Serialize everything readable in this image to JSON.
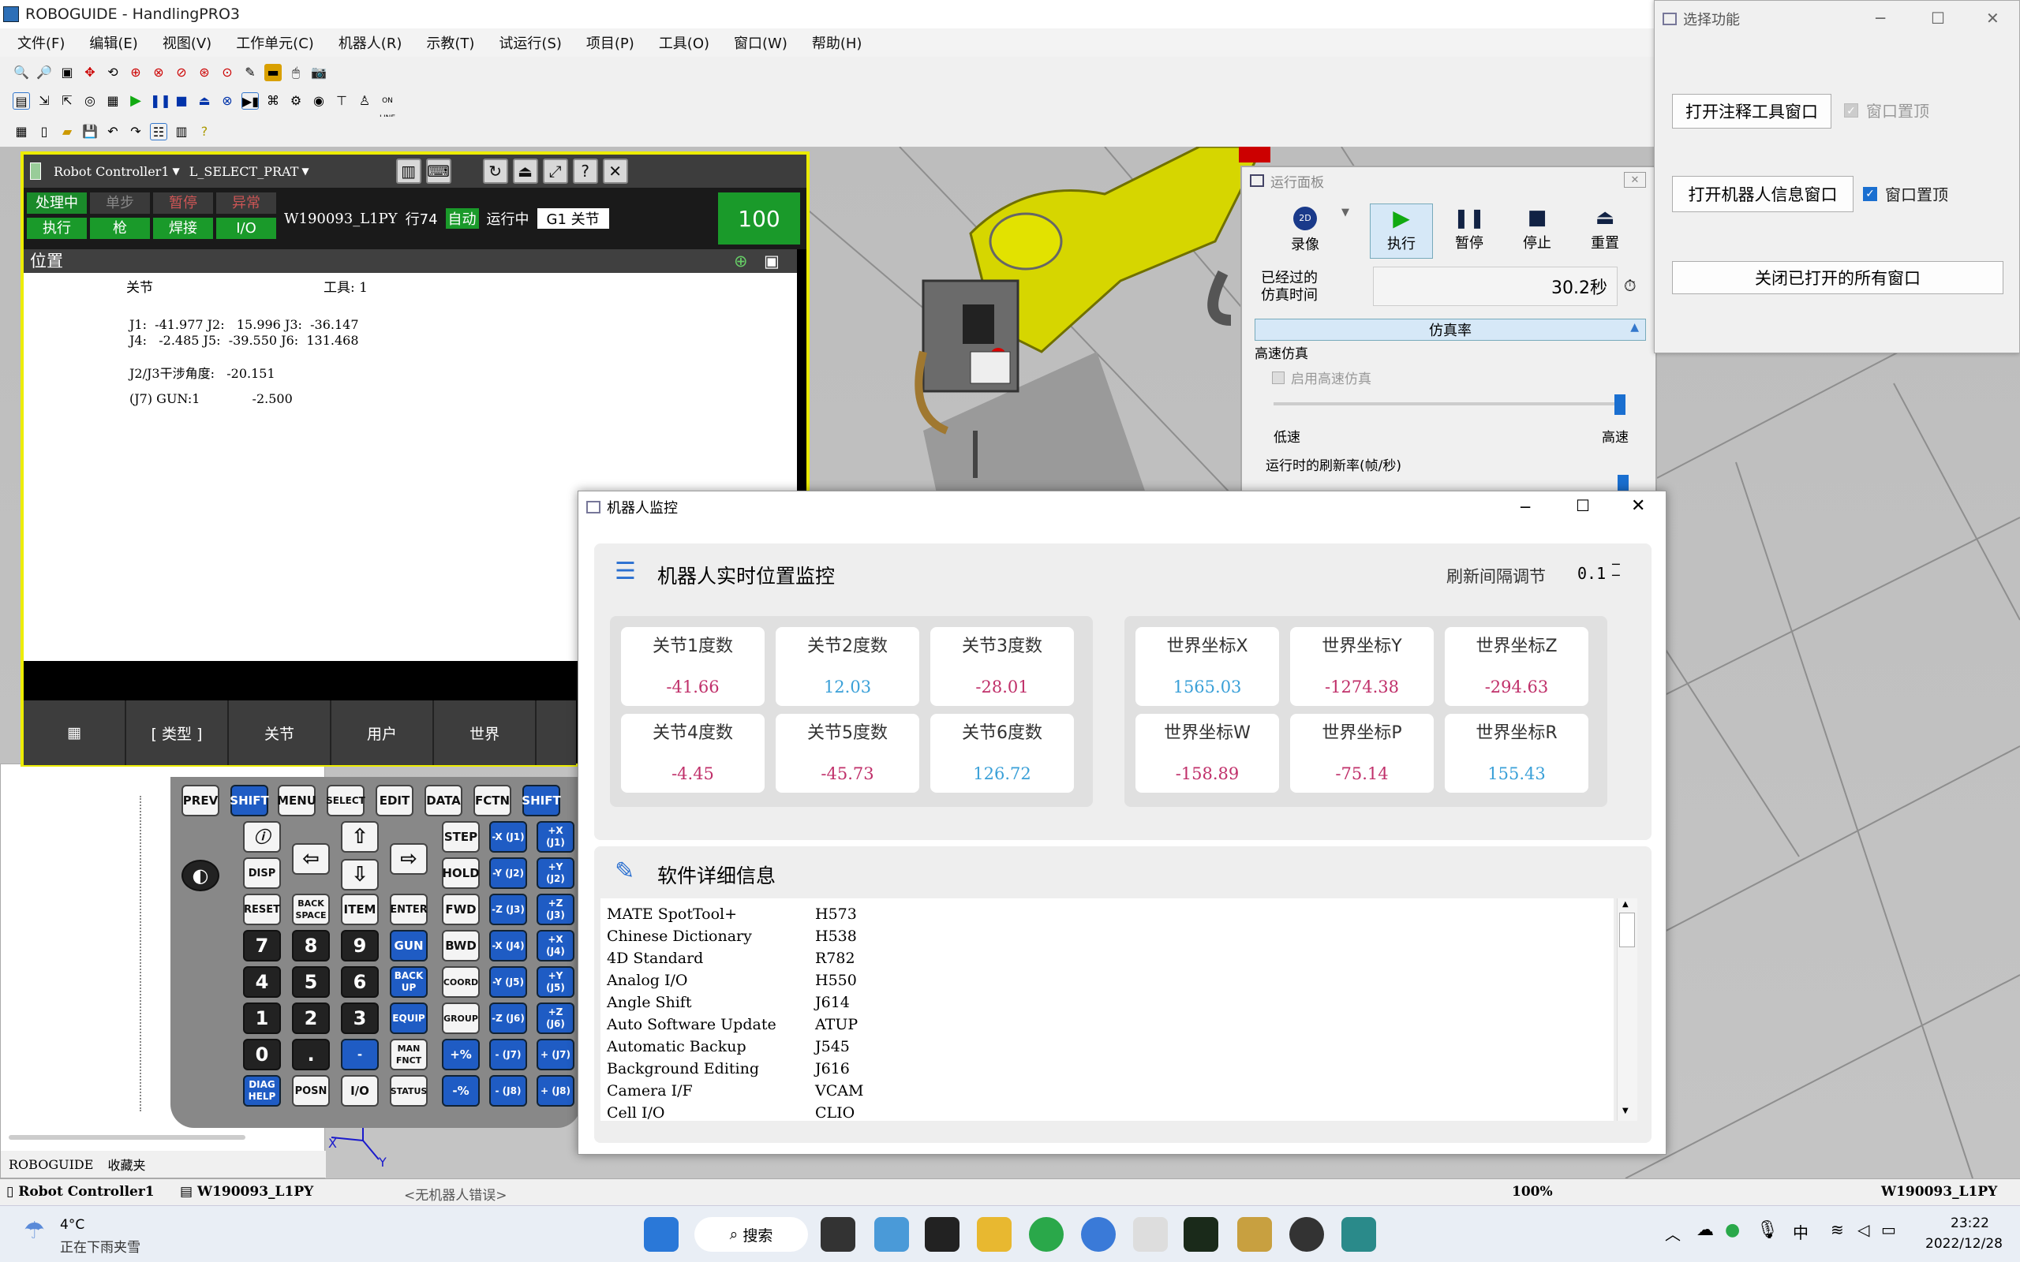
{
  "app": {
    "title": "ROBOGUIDE - HandlingPRO3"
  },
  "menu": [
    "文件(F)",
    "编辑(E)",
    "视图(V)",
    "工作单元(C)",
    "机器人(R)",
    "示教(T)",
    "试运行(S)",
    "项目(P)",
    "工具(O)",
    "窗口(W)",
    "帮助(H)"
  ],
  "pendant": {
    "controller": "Robot Controller1",
    "program_select": "L_SELECT_PRAT",
    "status_top": [
      "处理中",
      "单步",
      "暂停",
      "异常"
    ],
    "status_bottom": [
      "执行",
      "枪",
      "焊接",
      "I/O"
    ],
    "program": "W190093_L1PY",
    "line": "行74",
    "mode": "自动",
    "state": "运行中",
    "group": "G1 关节",
    "override": "100",
    "screen_title": "位置",
    "coord_label": "关节",
    "tool_label": "工具:  1",
    "joints_line1": "J1:  -41.977 J2:   15.996 J3:  -36.147",
    "joints_line2": "J4:   -2.485 J5:  -39.550 J6:  131.468",
    "interference": "J2/J3干涉角度:   -20.151",
    "gun": "(J7) GUN:1             -2.500",
    "fkeys": [
      "[ 类型 ]",
      "关节",
      "用户",
      "世界"
    ]
  },
  "keypad": {
    "r1": [
      "PREV",
      "SHIFT",
      "MENU",
      "SELECT",
      "EDIT",
      "DATA",
      "FCTN",
      "SHIFT"
    ],
    "r2": [
      "STEP",
      "-X (J1)",
      "+X (J1)"
    ],
    "r3": [
      "DISP",
      "HOLD",
      "-Y (J2)",
      "+Y (J2)"
    ],
    "r4": [
      "RESET",
      "BACK SPACE",
      "ITEM",
      "ENTER",
      "FWD",
      "-Z (J3)",
      "+Z (J3)"
    ],
    "r5": [
      "7",
      "8",
      "9",
      "GUN",
      "BWD",
      "-X (J4)",
      "+X (J4)"
    ],
    "r6": [
      "4",
      "5",
      "6",
      "BACK UP",
      "COORD",
      "-Y (J5)",
      "+Y (J5)"
    ],
    "r7": [
      "1",
      "2",
      "3",
      "EQUIP",
      "GROUP",
      "-Z (J6)",
      "+Z (J6)"
    ],
    "r8": [
      "0",
      ".",
      "-",
      "MAN FNCT",
      "+%",
      "- (J7)",
      "+ (J7)"
    ],
    "r9": [
      "DIAG HELP",
      "POSN",
      "I/O",
      "STATUS",
      "-%",
      "- (J8)",
      "+ (J8)"
    ]
  },
  "run_panel": {
    "title": "运行面板",
    "buttons": [
      "录像",
      "执行",
      "暂停",
      "停止",
      "重置"
    ],
    "elapsed_label1": "已经过的",
    "elapsed_label2": "仿真时间",
    "elapsed_value": "30.2秒",
    "sim_rate": "仿真率",
    "high_speed": "高速仿真",
    "enable_high_speed": "启用高速仿真",
    "low": "低速",
    "high": "高速",
    "refresh_rate": "运行时的刷新率(帧/秒)"
  },
  "select_window": {
    "title": "选择功能",
    "open_annotation": "打开注释工具窗口",
    "open_robot_info": "打开机器人信息窗口",
    "topmost": "窗口置顶",
    "close_all": "关闭已打开的所有窗口"
  },
  "monitor": {
    "title": "机器人监控",
    "section1": "机器人实时位置监控",
    "refresh_label": "刷新间隔调节",
    "refresh_value": "0.1",
    "joints": [
      {
        "label": "关节1度数",
        "value": "-41.66",
        "sign": "neg"
      },
      {
        "label": "关节2度数",
        "value": "12.03",
        "sign": "pos"
      },
      {
        "label": "关节3度数",
        "value": "-28.01",
        "sign": "neg"
      },
      {
        "label": "关节4度数",
        "value": "-4.45",
        "sign": "neg"
      },
      {
        "label": "关节5度数",
        "value": "-45.73",
        "sign": "neg"
      },
      {
        "label": "关节6度数",
        "value": "126.72",
        "sign": "pos"
      }
    ],
    "world": [
      {
        "label": "世界坐标X",
        "value": "1565.03",
        "sign": "pos"
      },
      {
        "label": "世界坐标Y",
        "value": "-1274.38",
        "sign": "neg"
      },
      {
        "label": "世界坐标Z",
        "value": "-294.63",
        "sign": "neg"
      },
      {
        "label": "世界坐标W",
        "value": "-158.89",
        "sign": "neg"
      },
      {
        "label": "世界坐标P",
        "value": "-75.14",
        "sign": "neg"
      },
      {
        "label": "世界坐标R",
        "value": "155.43",
        "sign": "pos"
      }
    ],
    "section2": "软件详细信息",
    "software": [
      [
        "MATE SpotTool+",
        "H573"
      ],
      [
        "Chinese Dictionary",
        "H538"
      ],
      [
        "4D Standard",
        "R782"
      ],
      [
        "Analog I/O",
        "H550"
      ],
      [
        "Angle Shift",
        "J614"
      ],
      [
        "Auto Software Update",
        "ATUP"
      ],
      [
        "Automatic Backup",
        "J545"
      ],
      [
        "Background Editing",
        "J616"
      ],
      [
        "Camera I/F",
        "VCAM"
      ],
      [
        "Cell I/O",
        "CLIO"
      ]
    ]
  },
  "left_panel": {
    "tab1": "ROBOGUIDE",
    "tab2": "收藏夹"
  },
  "statusbar": {
    "controller": "Robot Controller1",
    "program": "W190093_L1PY",
    "error": "<无机器人错误>",
    "zoom": "100%",
    "program_right": "W190093_L1PY"
  },
  "taskbar": {
    "weather_temp": "4°C",
    "weather_desc": "正在下雨夹雪",
    "search": "搜索",
    "ime": "中",
    "time": "23:22",
    "date": "2022/12/28"
  }
}
